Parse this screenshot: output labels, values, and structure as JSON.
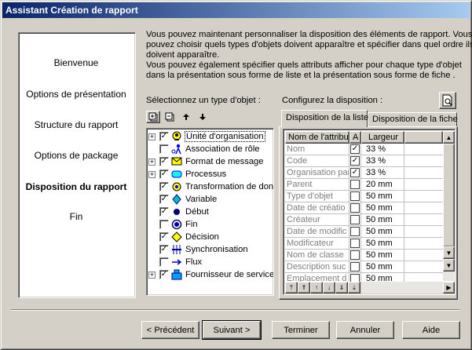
{
  "window": {
    "title": "Assistant Création de rapport"
  },
  "steps": [
    {
      "label": "Bienvenue",
      "active": false
    },
    {
      "label": "Options de présentation",
      "active": false
    },
    {
      "label": "Structure du rapport",
      "active": false
    },
    {
      "label": "Options de package",
      "active": false
    },
    {
      "label": "Disposition du rapport",
      "active": true
    },
    {
      "label": "Fin",
      "active": false
    }
  ],
  "intro": {
    "lines": [
      "Vous pouvez maintenant personnaliser la disposition des éléments de rapport. Vous",
      "pouvez choisir quels types d'objets doivent apparaître et spécifier dans quel ordre ils",
      "doivent apparaître.",
      "Vous pouvez également spécifier quels attributs afficher pour chaque type d'objet",
      "dans la présentation sous forme de liste et la présentation sous forme de fiche ."
    ]
  },
  "left": {
    "label": "Sélectionnez un type d'objet :",
    "toolbar": [
      {
        "name": "expand-all-button",
        "icon": "expand-all-icon"
      },
      {
        "name": "collapse-all-button",
        "icon": "collapse-all-icon"
      },
      {
        "name": "move-up-button",
        "icon": "arrow-up-icon"
      },
      {
        "name": "move-down-button",
        "icon": "arrow-down-icon"
      }
    ],
    "tree": [
      {
        "label": "Unité d'organisation",
        "checked": true,
        "expander": "+",
        "icon": "org-unit",
        "selected": true
      },
      {
        "label": "Association de rôle",
        "checked": false,
        "expander": "",
        "icon": "role"
      },
      {
        "label": "Format de message",
        "checked": true,
        "expander": "+",
        "icon": "message"
      },
      {
        "label": "Processus",
        "checked": true,
        "expander": "+",
        "icon": "process"
      },
      {
        "label": "Transformation de don",
        "checked": true,
        "expander": "",
        "icon": "transform"
      },
      {
        "label": "Variable",
        "checked": true,
        "expander": "",
        "icon": "variable"
      },
      {
        "label": "Début",
        "checked": true,
        "expander": "",
        "icon": "start"
      },
      {
        "label": "Fin",
        "checked": false,
        "expander": "",
        "icon": "end"
      },
      {
        "label": "Décision",
        "checked": true,
        "expander": "",
        "icon": "decision"
      },
      {
        "label": "Synchronisation",
        "checked": true,
        "expander": "",
        "icon": "sync"
      },
      {
        "label": "Flux",
        "checked": false,
        "expander": "",
        "icon": "flow"
      },
      {
        "label": "Fournisseur de service",
        "checked": true,
        "expander": "+",
        "icon": "provider"
      }
    ]
  },
  "right": {
    "label": "Configurez la disposition :",
    "preview_icon": "preview-icon",
    "tabs": [
      "Disposition de la liste",
      "Disposition de la fiche"
    ],
    "columns": [
      "Nom de l'attribut",
      "A",
      "Largeur"
    ],
    "rows": [
      {
        "name": "Nom",
        "checked": true,
        "width": "33 %",
        "dark": false
      },
      {
        "name": "Code",
        "checked": true,
        "width": "33 %",
        "dark": false
      },
      {
        "name": "Organisation par",
        "checked": true,
        "width": "33 %",
        "dark": false
      },
      {
        "name": "Parent",
        "checked": false,
        "width": "20 mm",
        "dark": false
      },
      {
        "name": "Type d'objet",
        "checked": false,
        "width": "50 mm",
        "dark": false
      },
      {
        "name": "Date de créatio",
        "checked": false,
        "width": "50 mm",
        "dark": false
      },
      {
        "name": "Créateur",
        "checked": false,
        "width": "50 mm",
        "dark": false
      },
      {
        "name": "Date de modific",
        "checked": false,
        "width": "50 mm",
        "dark": false
      },
      {
        "name": "Modificateur",
        "checked": false,
        "width": "50 mm",
        "dark": false
      },
      {
        "name": "Nom de classe",
        "checked": false,
        "width": "50 mm",
        "dark": false
      },
      {
        "name": "Description suc",
        "checked": false,
        "width": "50 mm",
        "dark": false
      },
      {
        "name": "Emplacement d",
        "checked": false,
        "width": "50 mm",
        "dark": false
      }
    ]
  },
  "footer": {
    "back": "< Précédent",
    "next": "Suivant >",
    "finish": "Terminer",
    "cancel": "Annuler",
    "help": "Aide"
  }
}
